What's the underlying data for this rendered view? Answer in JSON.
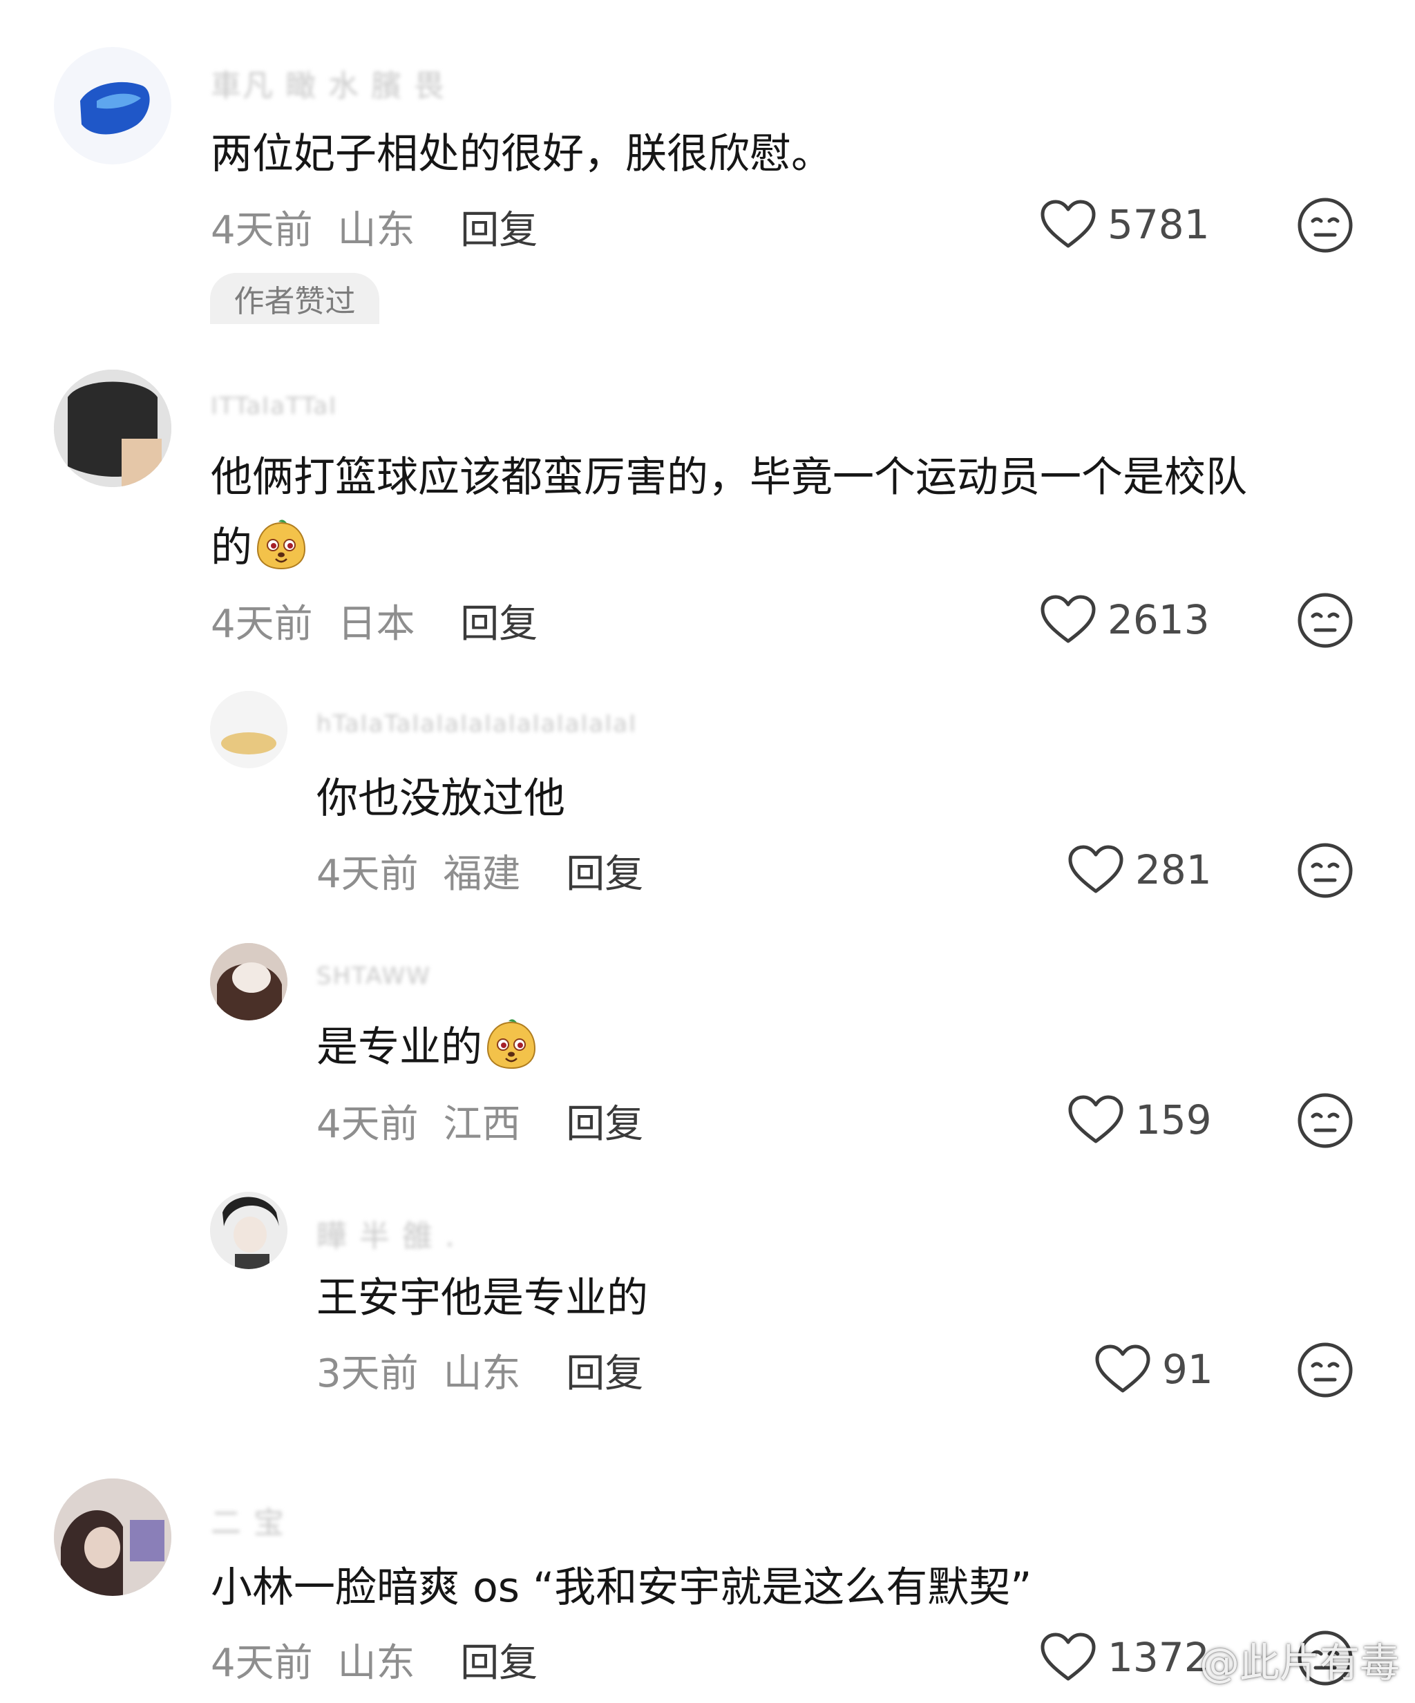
{
  "comments": [
    {
      "username": "車凡 瞰 水 臏 畏",
      "text": "两位妃子相处的很好，朕很欣慰。",
      "time": "4天前",
      "location": "山东",
      "reply": "回复",
      "likes": "5781",
      "tag": "作者赞过"
    },
    {
      "username": "ITTaIaTTaI",
      "text_line1": "他俩打篮球应该都蛮厉害的，毕竟一个运动员一个是校队",
      "text_line2": "的",
      "time": "4天前",
      "location": "日本",
      "reply": "回复",
      "likes": "2613"
    },
    {
      "username": "hTaIaTaIaIaIaIaIaIaIaIaIaI",
      "text": "你也没放过他",
      "time": "4天前",
      "location": "福建",
      "reply": "回复",
      "likes": "281"
    },
    {
      "username": "SHTAWW",
      "text": "是专业的",
      "time": "4天前",
      "location": "江西",
      "reply": "回复",
      "likes": "159"
    },
    {
      "username": "瞱 半 雒 .",
      "text": "王安宇他是专业的",
      "time": "3天前",
      "location": "山东",
      "reply": "回复",
      "likes": "91"
    },
    {
      "username": "二 宝",
      "text": "小林一脸暗爽 os “我和安宇就是这么有默契”",
      "time": "4天前",
      "location": "山东",
      "reply": "回复",
      "likes": "1372"
    }
  ],
  "watermark": "@此片有毒",
  "icons": {
    "like": "heart-outline-icon",
    "dislike": "neutral-face-icon",
    "emoji": "doge-emoji-icon"
  },
  "colors": {
    "text": "#161616",
    "meta": "#8e8e8e",
    "icon": "#4a4a4a"
  }
}
